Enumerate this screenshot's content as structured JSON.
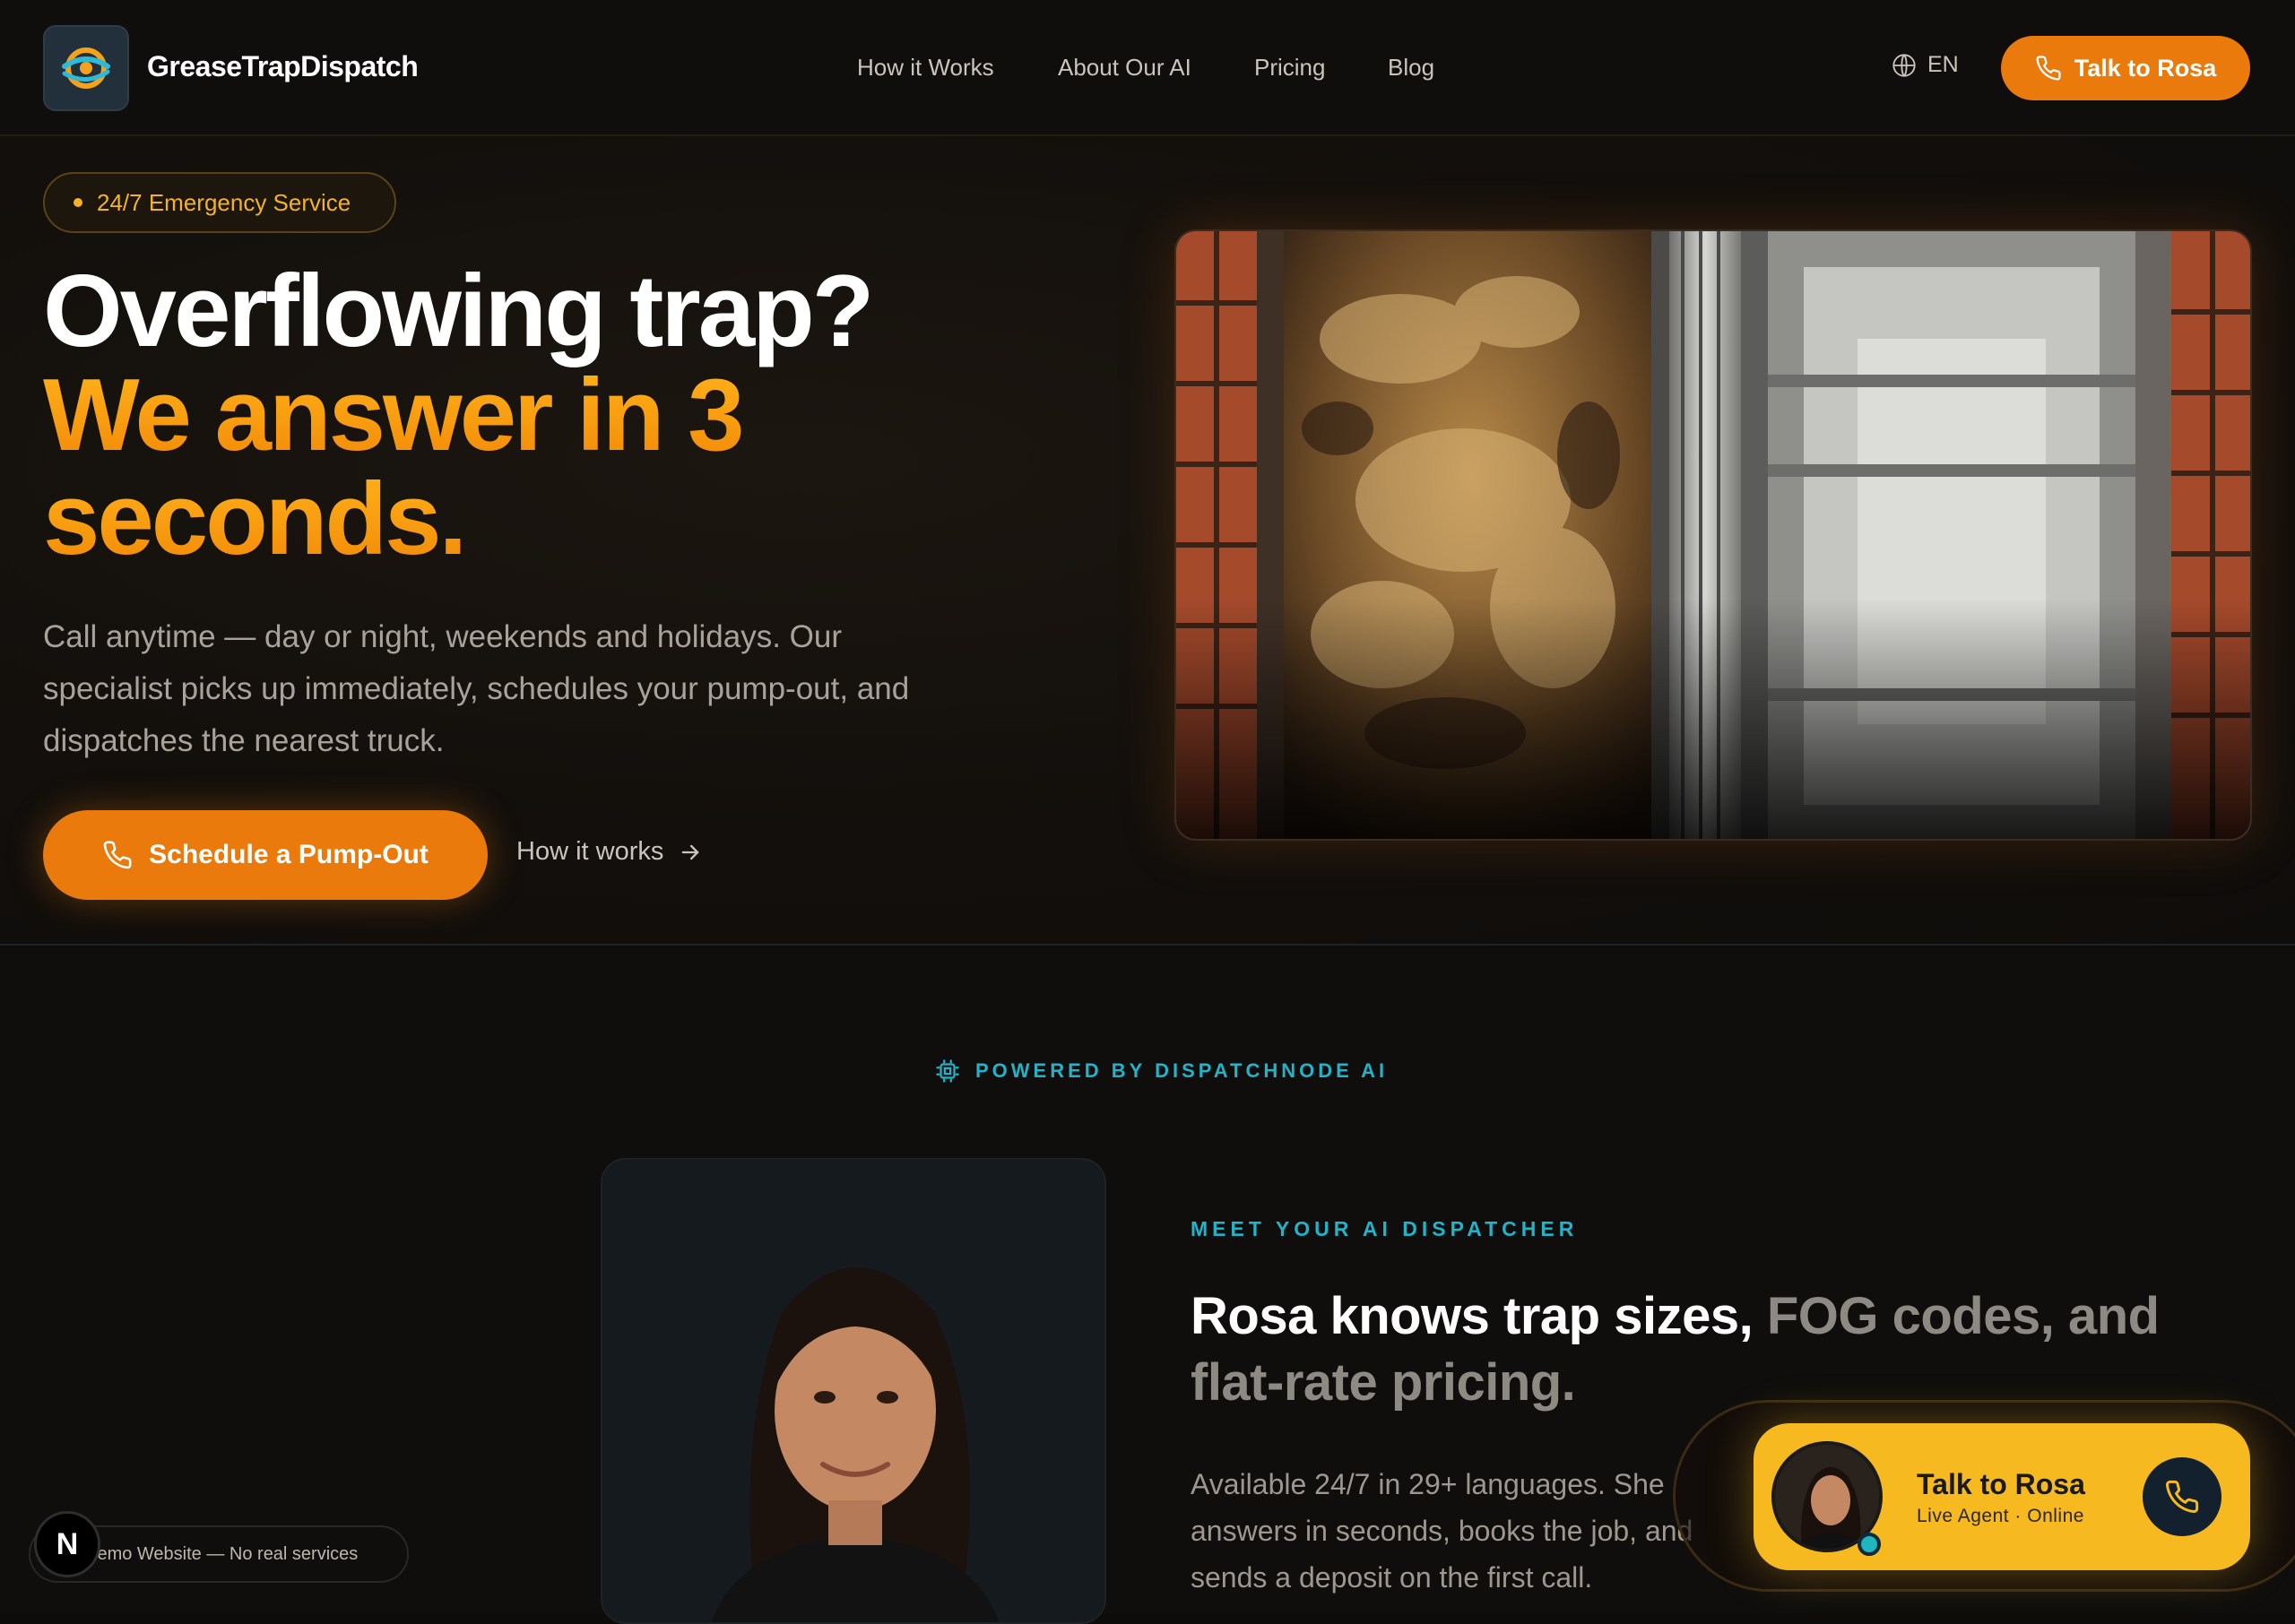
{
  "header": {
    "brand": "GreaseTrapDispatch",
    "nav": [
      "How it Works",
      "About Our AI",
      "Pricing",
      "Blog"
    ],
    "language": "EN",
    "cta_label": "Talk to Rosa"
  },
  "hero": {
    "badge": "24/7 Emergency Service",
    "headline_line1": "Overflowing trap?",
    "headline_line2": "We answer in 3",
    "headline_line3": "seconds.",
    "subtitle": "Call anytime — day or night, weekends and holidays. Our specialist picks up immediately, schedules your pump-out, and dispatches the nearest truck.",
    "primary_cta": "Schedule a Pump-Out",
    "secondary_cta": "How it works"
  },
  "ai_section": {
    "powered_by": "POWERED BY DISPATCHNODE AI",
    "eyebrow": "MEET YOUR AI DISPATCHER",
    "headline_white": "Rosa knows trap sizes, ",
    "headline_gray": "FOG codes, and flat-rate pricing.",
    "body": "Available 24/7 in 29+ languages. She answers in seconds, books the job, and sends a deposit on the first call."
  },
  "widget": {
    "title": "Talk to Rosa",
    "subtitle": "Live Agent · Online"
  },
  "demo": {
    "badge_letter": "N",
    "label": "Demo Website — No real services"
  },
  "colors": {
    "accent_orange": "#ea7a0c",
    "accent_yellow": "#f6b91f",
    "teal": "#22b3c9",
    "background": "#0e0c0a"
  },
  "icons": [
    "logo-icon",
    "globe-icon",
    "phone-icon",
    "arrow-right-icon",
    "chip-icon"
  ]
}
